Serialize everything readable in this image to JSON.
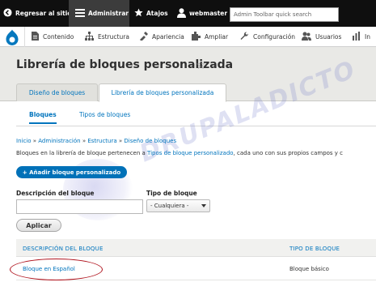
{
  "toolbar": {
    "back_label": "Regresar al sitio",
    "admin_label": "Administrar",
    "shortcuts_label": "Atajos",
    "user_label": "webmaster",
    "search_placeholder": "Admin Toolbar quick search"
  },
  "tray": {
    "items": [
      {
        "label": "Contenido",
        "icon": "content-icon"
      },
      {
        "label": "Estructura",
        "icon": "structure-icon"
      },
      {
        "label": "Apariencia",
        "icon": "appearance-icon"
      },
      {
        "label": "Ampliar",
        "icon": "extend-icon"
      },
      {
        "label": "Configuración",
        "icon": "wrench-icon"
      },
      {
        "label": "Usuarios",
        "icon": "people-icon"
      },
      {
        "label": "In",
        "icon": "reports-icon"
      }
    ]
  },
  "page": {
    "title": "Librería de bloques personalizada",
    "star": "☆",
    "primary_tabs": [
      "Diseño de bloques",
      "Librería de bloques personalizada"
    ],
    "secondary_tabs": [
      "Bloques",
      "Tipos de bloques"
    ],
    "breadcrumb": [
      "Inicio",
      "Administración",
      "Estructura",
      "Diseño de bloques"
    ],
    "breadcrumb_sep": " » ",
    "desc_pre": "Bloques en la librería de bloque pertenecen a ",
    "desc_link": "Tipos de bloque personalizado",
    "desc_post": ", cada uno con sus propios campos y c",
    "add_button": "+ Añadir bloque personalizado"
  },
  "filters": {
    "desc_label": "Descripción del bloque",
    "desc_value": "",
    "type_label": "Tipo de bloque",
    "type_selected": "- Cualquiera -",
    "apply": "Aplicar"
  },
  "table": {
    "headers": [
      "DESCRIPCIÓN DEL BLOQUE",
      "TIPO DE BLOQUE"
    ],
    "rows": [
      {
        "description": "Bloque en Español",
        "type": "Bloque básico"
      }
    ]
  },
  "watermark": "DRUPALADICTO",
  "colors": {
    "link": "#0074bd",
    "primary_button": "#0071b8",
    "toolbar": "#0f0f0f",
    "annotation": "#b0141e"
  }
}
